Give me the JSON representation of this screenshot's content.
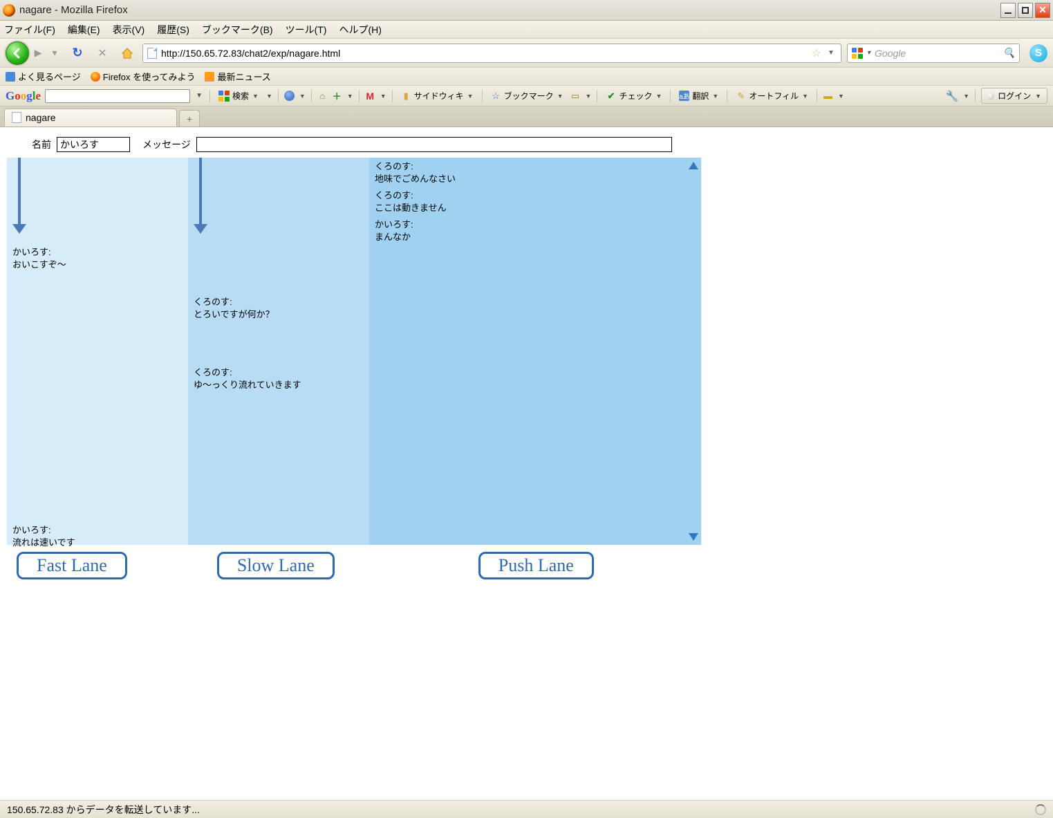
{
  "window": {
    "title": "nagare - Mozilla Firefox"
  },
  "menu": {
    "file": "ファイル(F)",
    "edit": "編集(E)",
    "view": "表示(V)",
    "history": "履歴(S)",
    "bookmarks": "ブックマーク(B)",
    "tools": "ツール(T)",
    "help": "ヘルプ(H)"
  },
  "nav": {
    "url": "http://150.65.72.83/chat2/exp/nagare.html",
    "search_placeholder": "Google"
  },
  "bookmarks_bar": {
    "b1": "よく見るページ",
    "b2": "Firefox を使ってみよう",
    "b3": "最新ニュース"
  },
  "gtoolbar": {
    "search": "検索",
    "sidewiki": "サイドウィキ",
    "bookmark": "ブックマーク",
    "check": "チェック",
    "translate": "翻訳",
    "autofill": "オートフィル",
    "login": "ログイン"
  },
  "tab": {
    "title": "nagare"
  },
  "page": {
    "name_label": "名前",
    "name_value": "かいろす",
    "message_label": "メッセージ"
  },
  "lane1": {
    "label": "Fast Lane",
    "m1_user": "かいろす:",
    "m1_text": "おいこすぞ～",
    "m2_user": "かいろす:",
    "m2_text": "流れは速いです"
  },
  "lane2": {
    "label": "Slow Lane",
    "m1_user": "くろのす:",
    "m1_text": "とろいですが何か？",
    "m2_user": "くろのす:",
    "m2_text": "ゆ～っくり流れていきます"
  },
  "lane3": {
    "label": "Push Lane",
    "m1_user": "くろのす:",
    "m1_text": "地味でごめんなさい",
    "m2_user": "くろのす:",
    "m2_text": "ここは動きません",
    "m3_user": "かいろす:",
    "m3_text": "まんなか"
  },
  "status": {
    "text": "150.65.72.83 からデータを転送しています..."
  }
}
